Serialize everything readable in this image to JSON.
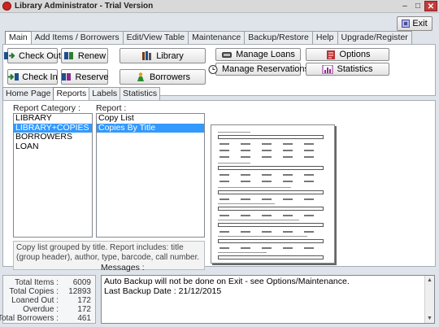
{
  "window": {
    "title": "Library Administrator - Trial Version",
    "minimize": "–",
    "maximize": "□",
    "close": "✕"
  },
  "exit_label": "Exit",
  "main_tabs": [
    "Main",
    "Add Items / Borrowers",
    "Edit/View Table",
    "Maintenance",
    "Backup/Restore",
    "Help",
    "Upgrade/Register"
  ],
  "buttons": {
    "check_out": "Check Out",
    "renew": "Renew",
    "library": "Library",
    "manage_loans": "Manage Loans",
    "options": "Options",
    "check_in": "Check In",
    "reserve": "Reserve",
    "borrowers": "Borrowers",
    "manage_reservations": "Manage Reservations",
    "statistics": "Statistics"
  },
  "sub_tabs": [
    "Home Page",
    "Reports",
    "Labels",
    "Statistics"
  ],
  "reports": {
    "category_label": "Report Category :",
    "categories": [
      "LIBRARY",
      "LIBRARY+COPIES",
      "BORROWERS",
      "LOAN"
    ],
    "selected_category_index": 1,
    "report_label": "Report :",
    "reports": [
      "Copy List",
      "Copies By Title"
    ],
    "selected_report_index": 1,
    "description": "Copy list grouped by title. Report includes: title (group header), author, type, barcode, call number."
  },
  "messages_label": "Messages :",
  "stats": [
    {
      "label": "Total Items :",
      "value": "6009"
    },
    {
      "label": "Total Copies :",
      "value": "12893"
    },
    {
      "label": "Loaned Out :",
      "value": "172"
    },
    {
      "label": "Overdue :",
      "value": "172"
    },
    {
      "label": "Total Borrowers :",
      "value": "461"
    }
  ],
  "messages": [
    "Auto Backup will not be done on Exit - see Options/Maintenance.",
    "Last Backup Date : 21/12/2015"
  ],
  "icons": {
    "app": "app-logo-icon",
    "exit": "exit-door-icon"
  }
}
